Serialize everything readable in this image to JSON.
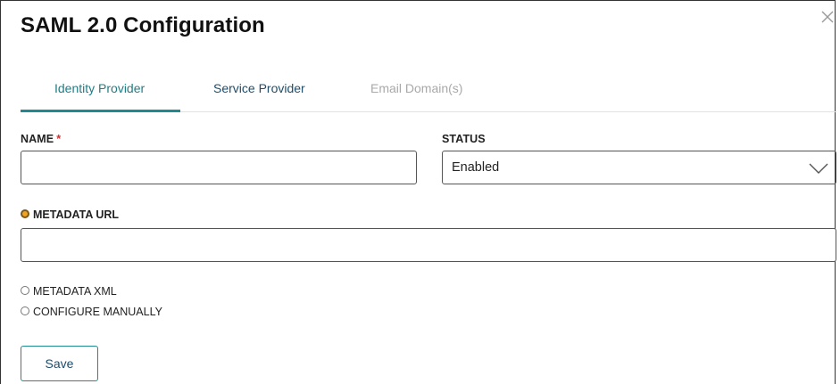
{
  "dialog": {
    "title": "SAML 2.0 Configuration",
    "close_icon": "close-icon"
  },
  "tabs": [
    {
      "label": "Identity Provider",
      "state": "active"
    },
    {
      "label": "Service Provider",
      "state": "normal"
    },
    {
      "label": "Email Domain(s)",
      "state": "disabled"
    }
  ],
  "form": {
    "name": {
      "label": "NAME",
      "required_mark": "*",
      "value": ""
    },
    "status": {
      "label": "STATUS",
      "value": "Enabled",
      "icon": "chevron-down-icon"
    },
    "metadata_source": {
      "options": [
        {
          "label": "METADATA URL",
          "selected": true
        },
        {
          "label": "METADATA XML",
          "selected": false
        },
        {
          "label": "CONFIGURE MANUALLY",
          "selected": false
        }
      ]
    },
    "metadata_url": {
      "value": ""
    },
    "save_label": "Save"
  },
  "colors": {
    "accent": "#1f8a8f",
    "tab_text": "#1d4d6b",
    "required": "#d32f2f",
    "radio_selected": "#f0a422"
  }
}
